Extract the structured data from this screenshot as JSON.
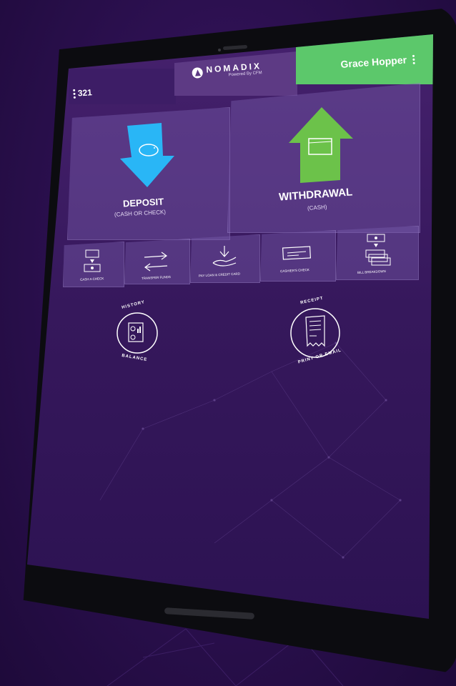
{
  "topbar": {
    "user_count": "321",
    "logo_name": "NOMADIX",
    "logo_sub": "Powered By CFM",
    "user_name": "Grace Hopper"
  },
  "main_actions": [
    {
      "title": "DEPOSIT",
      "subtitle": "(CASH OR CHECK)",
      "icon": "arrow-down-piggy-bank-icon",
      "color": "#29b6f6"
    },
    {
      "title": "WITHDRAWAL",
      "subtitle": "(CASH)",
      "icon": "arrow-up-wallet-icon",
      "color": "#6cc24a"
    }
  ],
  "secondary_actions": [
    {
      "label": "CASH A CHECK",
      "icon": "cash-a-check-icon"
    },
    {
      "label": "TRANSFER FUNDS",
      "icon": "transfer-arrows-icon"
    },
    {
      "label": "PAY LOAN & CREDIT CARD",
      "icon": "hand-pay-icon"
    },
    {
      "label": "CASHIER'S CHECK",
      "icon": "check-icon"
    },
    {
      "label": "BILL BREAKDOWN",
      "icon": "bill-stack-icon"
    }
  ],
  "circle_actions": [
    {
      "top_label": "HISTORY",
      "bottom_label": "BALANCE",
      "icon": "history-balance-icon"
    },
    {
      "top_label": "RECEIPT",
      "bottom_label": "PRINT OR EMAIL",
      "icon": "receipt-icon"
    }
  ],
  "colors": {
    "accent_green": "#5cc86b",
    "accent_blue": "#29b6f6",
    "background": "#2a0f4d"
  }
}
